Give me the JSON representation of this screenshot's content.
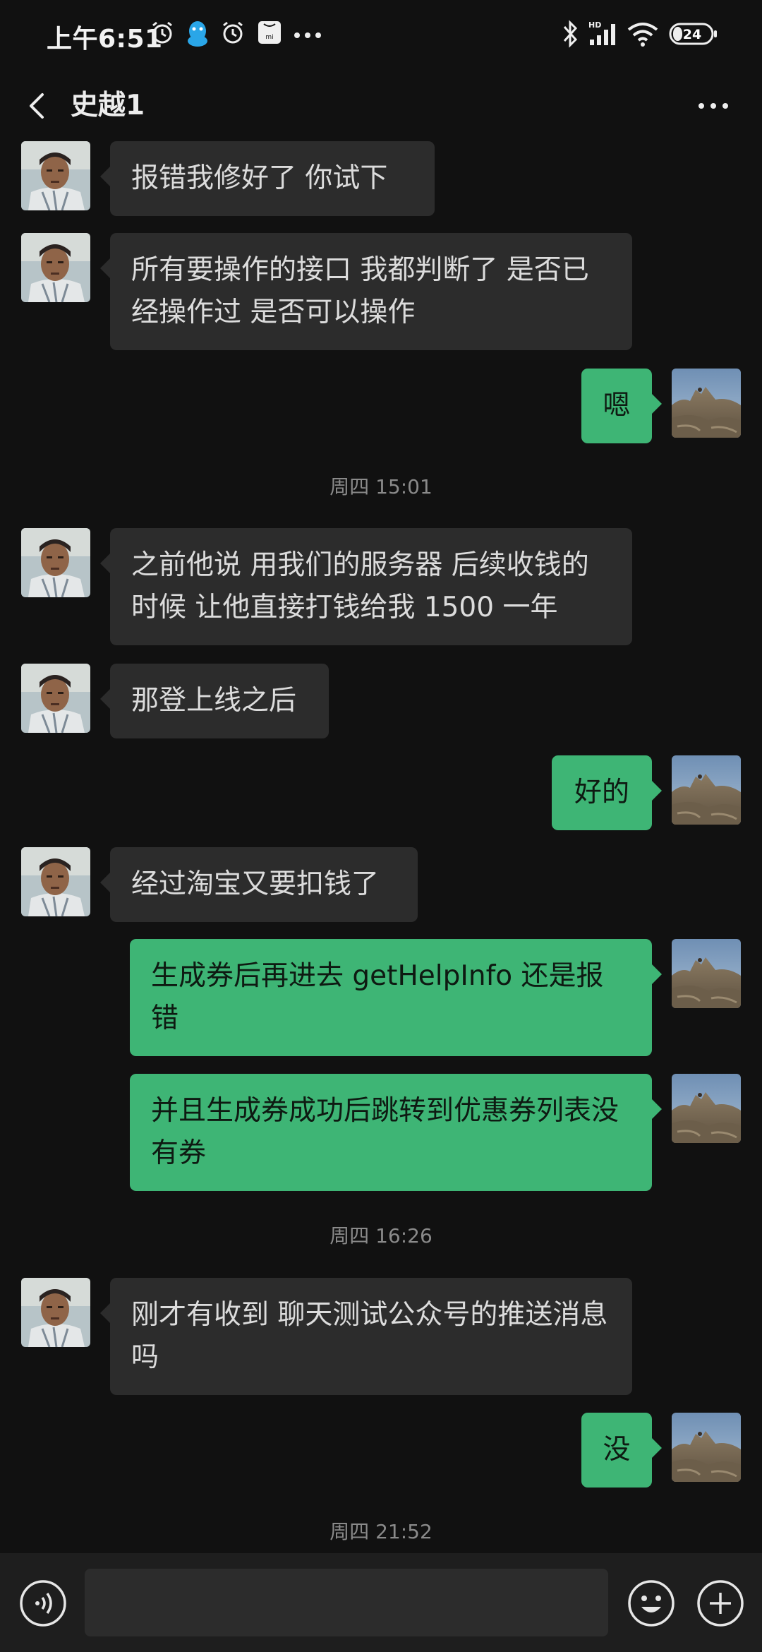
{
  "status_bar": {
    "time": "上午6:51",
    "icons": [
      "alarm-icon",
      "qq-icon",
      "alarm-icon",
      "mi-icon",
      "more-dots-icon",
      "bluetooth-icon",
      "signal-hd-icon",
      "wifi-icon",
      "battery-icon"
    ],
    "battery": "24"
  },
  "header": {
    "back_icon": "chevron-left-icon",
    "title": "史越1",
    "more_icon": "more-dots-icon"
  },
  "messages": [
    {
      "from": "them",
      "text": "报错我修好了  你试下"
    },
    {
      "from": "them",
      "text": "所有要操作的接口 我都判断了 是否已经操作过  是否可以操作"
    },
    {
      "from": "me",
      "text": "嗯"
    },
    {
      "timestamp": "周四 15:01"
    },
    {
      "from": "them",
      "text": "之前他说 用我们的服务器 后续收钱的时候 让他直接打钱给我 1500 一年"
    },
    {
      "from": "them",
      "text": "那登上线之后"
    },
    {
      "from": "me",
      "text": "好的"
    },
    {
      "from": "them",
      "text": "经过淘宝又要扣钱了"
    },
    {
      "from": "me",
      "text": "生成券后再进去 getHelpInfo 还是报错"
    },
    {
      "from": "me",
      "text": "并且生成券成功后跳转到优惠券列表没有券"
    },
    {
      "timestamp": "周四 16:26"
    },
    {
      "from": "them",
      "text": "刚才有收到 聊天测试公众号的推送消息吗"
    },
    {
      "from": "me",
      "text": "没"
    },
    {
      "timestamp": "周四 21:52"
    }
  ],
  "input_bar": {
    "voice_icon": "voice-icon",
    "message_value": "",
    "emoji_icon": "emoji-icon",
    "add_icon": "plus-circle-icon"
  },
  "colors": {
    "background": "#111111",
    "incoming_bubble": "#2c2c2c",
    "outgoing_bubble": "#3eb575",
    "timestamp_text": "#8a8a8a"
  }
}
